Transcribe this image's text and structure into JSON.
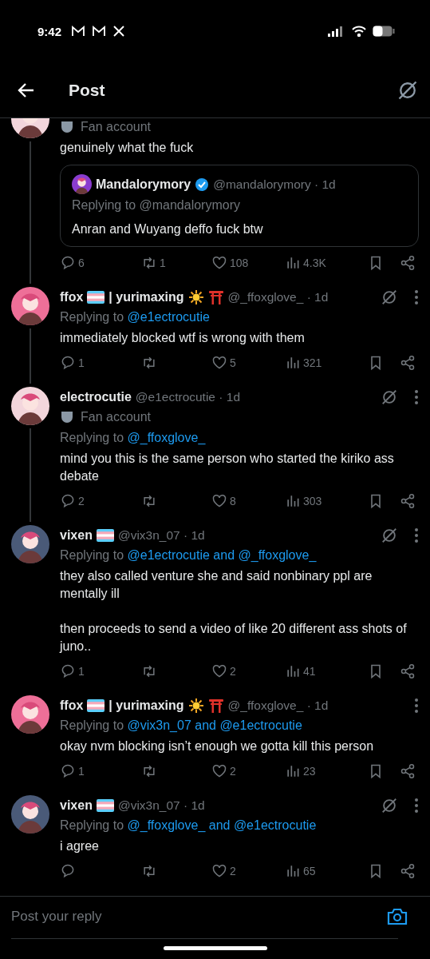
{
  "status_bar": {
    "time": "9:42"
  },
  "header": {
    "title": "Post"
  },
  "posts": [
    {
      "avatar": {
        "color": "#f3d6dc"
      },
      "thread_line": true,
      "fan_label": "Fan account",
      "text": "genuinely what the fuck",
      "quote": {
        "avatar": {
          "color": "#8a3ccf"
        },
        "name": "Mandalorymory",
        "verified": true,
        "meta": "@mandalorymory · 1d",
        "replying": "Replying to @mandalorymory",
        "text": "Anran and Wuyang deffo fuck btw"
      },
      "stats": {
        "replies": "6",
        "reposts": "1",
        "likes": "108",
        "views": "4.3K"
      }
    },
    {
      "avatar": {
        "color": "#ee6f98"
      },
      "thread_line": true,
      "name_parts": [
        {
          "kind": "text",
          "text": "ffox"
        },
        {
          "kind": "flag"
        },
        {
          "kind": "text",
          "text": "| yurimaxing"
        },
        {
          "kind": "sun"
        },
        {
          "kind": "torii"
        }
      ],
      "meta": "@_ffoxglove_ · 1d",
      "grok": true,
      "replying": "Replying to",
      "mentions": "@e1ectrocutie",
      "text": "immediately blocked wtf is wrong with them",
      "stats": {
        "replies": "1",
        "likes": "5",
        "views": "321"
      }
    },
    {
      "avatar": {
        "color": "#f3d6dc"
      },
      "thread_line": true,
      "name_parts": [
        {
          "kind": "text",
          "text": "electrocutie"
        }
      ],
      "meta": "@e1ectrocutie · 1d",
      "grok": true,
      "fan_label": "Fan account",
      "replying": "Replying to",
      "mentions": "@_ffoxglove_",
      "text": "mind you this is the same person who started the kiriko ass debate",
      "stats": {
        "replies": "2",
        "likes": "8",
        "views": "303"
      }
    },
    {
      "avatar": {
        "color": "#4a5a78"
      },
      "thread_line": false,
      "name_parts": [
        {
          "kind": "text",
          "text": "vixen"
        },
        {
          "kind": "flag"
        }
      ],
      "meta": "@vix3n_07 · 1d",
      "grok": true,
      "replying": "Replying to",
      "mentions": "@e1ectrocutie and @_ffoxglove_",
      "text": "they also called venture she and said nonbinary ppl are mentally ill\n\nthen proceeds to send a video of like 20 different ass shots of juno..",
      "stats": {
        "replies": "1",
        "likes": "2",
        "views": "41"
      }
    },
    {
      "avatar": {
        "color": "#ee6f98"
      },
      "thread_line": false,
      "name_parts": [
        {
          "kind": "text",
          "text": "ffox"
        },
        {
          "kind": "flag"
        },
        {
          "kind": "text",
          "text": "| yurimaxing"
        },
        {
          "kind": "sun"
        },
        {
          "kind": "torii"
        }
      ],
      "meta": "@_ffoxglove_ · 1d",
      "grok": false,
      "replying": "Replying to",
      "mentions": "@vix3n_07 and @e1ectrocutie",
      "text": "okay nvm blocking isn’t enough we gotta kill this person",
      "stats": {
        "replies": "1",
        "likes": "2",
        "views": "23"
      }
    },
    {
      "avatar": {
        "color": "#4a5a78"
      },
      "thread_line": false,
      "name_parts": [
        {
          "kind": "text",
          "text": "vixen"
        },
        {
          "kind": "flag"
        }
      ],
      "meta": "@vix3n_07 · 1d",
      "grok": true,
      "replying": "Replying to",
      "mentions": "@_ffoxglove_ and @e1ectrocutie",
      "text": "i agree",
      "stats": {
        "likes": "2",
        "views": "65"
      }
    }
  ],
  "reply_bar": {
    "placeholder": "Post your reply"
  }
}
